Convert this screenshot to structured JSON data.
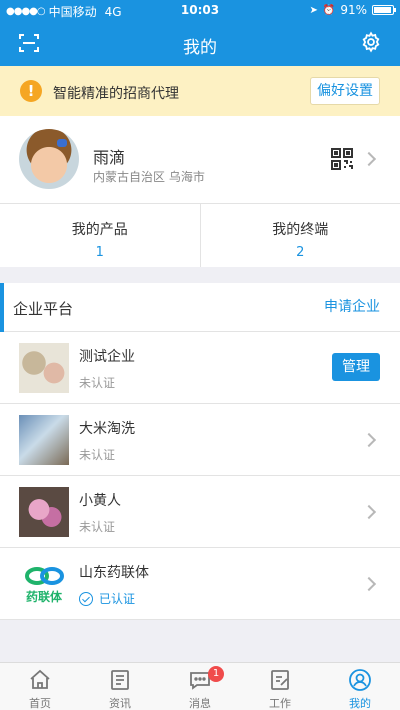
{
  "status_bar": {
    "carrier": "中国移动",
    "network": "4G",
    "time": "10:03",
    "battery": "91%"
  },
  "nav": {
    "title": "我的",
    "left_icon": "scan-icon",
    "right_icon": "gear-icon"
  },
  "banner": {
    "text": "智能精准的招商代理",
    "button": "偏好设置"
  },
  "profile": {
    "name": "雨滴",
    "location": "内蒙古自治区 乌海市"
  },
  "stats": [
    {
      "label": "我的产品",
      "value": "1"
    },
    {
      "label": "我的终端",
      "value": "2"
    }
  ],
  "enterprise": {
    "title": "企业平台",
    "apply_label": "申请企业",
    "items": [
      {
        "name": "测试企业",
        "status": "未认证",
        "action": "管理"
      },
      {
        "name": "大米淘洗",
        "status": "未认证"
      },
      {
        "name": "小黄人",
        "status": "未认证"
      },
      {
        "name": "山东药联体",
        "status": "已认证",
        "logo_text": "药联体"
      }
    ]
  },
  "tabs": [
    {
      "label": "首页",
      "icon": "home-icon"
    },
    {
      "label": "资讯",
      "icon": "news-icon"
    },
    {
      "label": "消息",
      "icon": "message-icon",
      "badge": "1"
    },
    {
      "label": "工作",
      "icon": "work-icon"
    },
    {
      "label": "我的",
      "icon": "profile-icon",
      "active": true
    }
  ],
  "colors": {
    "primary": "#1a93e0",
    "banner_bg": "#fdf1c3",
    "warn": "#f5a623",
    "badge": "#f04b4b"
  }
}
